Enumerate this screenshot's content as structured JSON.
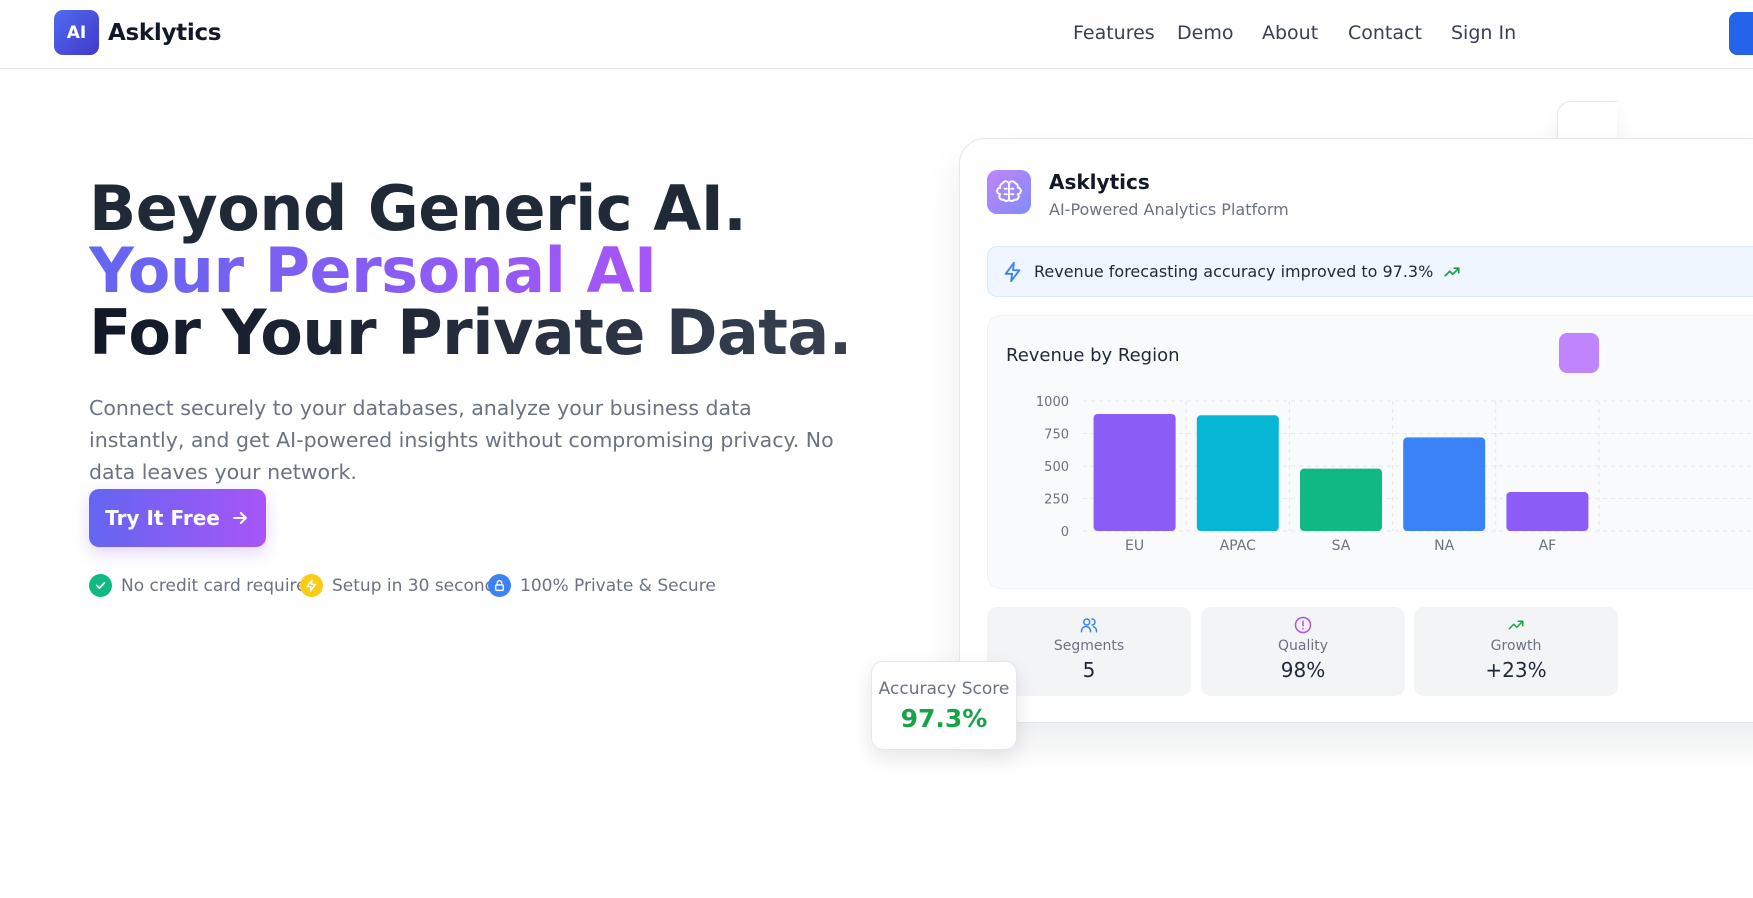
{
  "nav": {
    "logo_text": "AI",
    "brand": "Asklytics",
    "links": [
      "Features",
      "Demo",
      "About",
      "Contact"
    ],
    "sign_in": "Sign In"
  },
  "hero": {
    "line1": "Beyond Generic AI.",
    "line2": "Your Personal AI",
    "line3": "For Your Private Data.",
    "subtitle": "Connect securely to your databases, analyze your business data instantly, and get AI-powered insights without compromising privacy. No data leaves your network.",
    "cta": "Try It Free",
    "badges": [
      "No credit card required",
      "Setup in 30 seconds",
      "100% Private & Secure"
    ]
  },
  "card": {
    "title": "Asklytics",
    "subtitle": "AI-Powered Analytics Platform",
    "alert": "Revenue forecasting accuracy improved to 97.3%",
    "chart_title": "Revenue by Region",
    "stats": [
      {
        "label": "Segments",
        "value": "5",
        "icon": "users-icon"
      },
      {
        "label": "Quality",
        "value": "98%",
        "icon": "alert-circle-icon"
      },
      {
        "label": "Growth",
        "value": "+23%",
        "icon": "trending-up-icon"
      }
    ]
  },
  "accuracy": {
    "label": "Accuracy Score",
    "value": "97.3%"
  },
  "colors": {
    "primary": "#6366f1",
    "accent": "#a855f7",
    "blue": "#2563eb",
    "green": "#16a34a"
  },
  "chart_data": {
    "type": "bar",
    "title": "Revenue by Region",
    "categories": [
      "EU",
      "APAC",
      "SA",
      "NA",
      "AF"
    ],
    "values": [
      900,
      890,
      480,
      720,
      300
    ],
    "colors": [
      "#8b5cf6",
      "#06b6d4",
      "#10b981",
      "#3b82f6",
      "#8b5cf6"
    ],
    "yticks": [
      0,
      250,
      500,
      750,
      1000
    ],
    "ylim": [
      0,
      1000
    ],
    "grid": true
  }
}
